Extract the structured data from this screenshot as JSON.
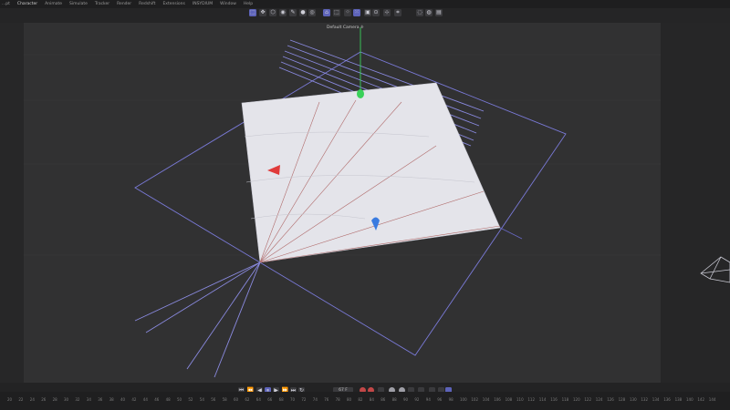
{
  "menu": {
    "items": [
      "...pt",
      "Character",
      "Animate",
      "Simulate",
      "Tracker",
      "Render",
      "Redshift",
      "Extensions",
      "INSYDIUM",
      "Window",
      "Help"
    ],
    "active_index": 1
  },
  "toolbar": {
    "icons": [
      "select-icon",
      "move-icon",
      "polygon-icon",
      "sphere-icon",
      "pen-icon",
      "sculpt-icon",
      "live-selection-icon",
      "model-mode-icon",
      "object-mode-icon",
      "point-mode-icon",
      "edge-mode-icon",
      "polygon-mode-icon",
      "snap-icon",
      "axis-icon",
      "workplane-icon",
      "render-region-icon",
      "render-view-icon",
      "render-settings-icon"
    ],
    "selected": [
      0,
      7,
      10
    ]
  },
  "viewport": {
    "camera_label": "Default Camera",
    "camera_suffix": "⁜"
  },
  "timeline": {
    "current_frame": "67 F",
    "ruler_ticks": [
      "20",
      "22",
      "24",
      "26",
      "28",
      "30",
      "32",
      "34",
      "36",
      "38",
      "40",
      "42",
      "44",
      "46",
      "48",
      "50",
      "52",
      "54",
      "56",
      "58",
      "60",
      "62",
      "64",
      "66",
      "68",
      "70",
      "72",
      "74",
      "76",
      "78",
      "80",
      "82",
      "84",
      "86",
      "88",
      "90",
      "92",
      "94",
      "96",
      "98",
      "100",
      "102",
      "104",
      "106",
      "108",
      "110",
      "112",
      "114",
      "116",
      "118",
      "120",
      "122",
      "124",
      "126",
      "128",
      "130",
      "132",
      "134",
      "136",
      "138",
      "140",
      "142",
      "144"
    ]
  },
  "colors": {
    "accent": "#5d63b9",
    "x_axis": "#e03a3a",
    "y_axis": "#3ad15a",
    "z_axis": "#3a7be0",
    "wire": "#7a7ad8"
  }
}
